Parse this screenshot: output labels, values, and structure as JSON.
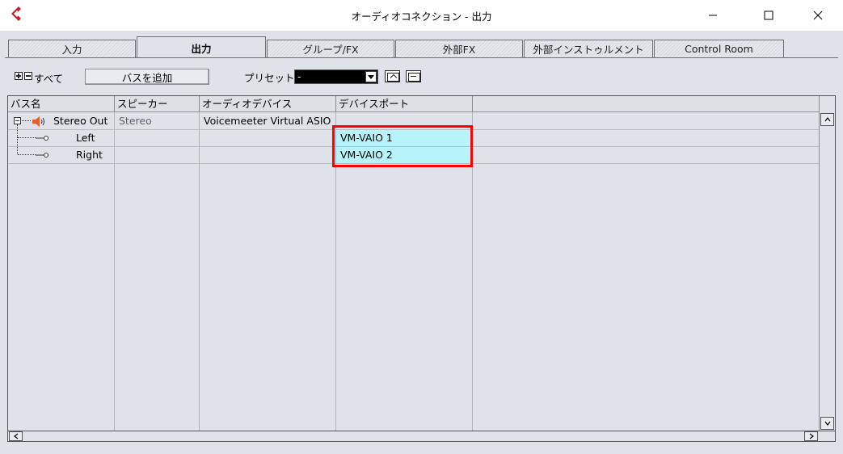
{
  "window": {
    "title": "オーディオコネクション - 出力",
    "app_icon": "cubase-logo",
    "logo_color": "#c3202a"
  },
  "tabs": [
    {
      "label": "入力",
      "active": false
    },
    {
      "label": "出力",
      "active": true
    },
    {
      "label": "グループ/FX",
      "active": false
    },
    {
      "label": "外部FX",
      "active": false
    },
    {
      "label": "外部インストゥルメント",
      "active": false
    },
    {
      "label": "Control Room",
      "active": false
    }
  ],
  "toolbar": {
    "all_label": "すべて",
    "add_bus_label": "バスを追加",
    "preset_label": "プリセット",
    "preset_value": "-"
  },
  "table": {
    "columns": [
      "バス名",
      "スピーカー",
      "オーディオデバイス",
      "デバイスポート"
    ],
    "rows": [
      {
        "bus_name": "Stereo Out",
        "speaker": "Stereo",
        "device": "Voicemeeter Virtual ASIO",
        "port": ""
      },
      {
        "bus_name": "Left",
        "speaker": "",
        "device": "",
        "port": "VM-VAIO 1"
      },
      {
        "bus_name": "Right",
        "speaker": "",
        "device": "",
        "port": "VM-VAIO 2"
      }
    ]
  },
  "colors": {
    "selected_cell": "#b6f3fb",
    "highlight_box": "#ff0000",
    "speaker_icon": "#e0612b"
  }
}
